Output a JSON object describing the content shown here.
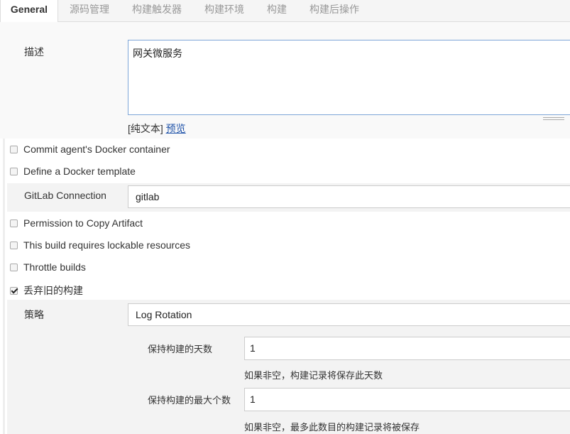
{
  "tabs": [
    {
      "label": "General",
      "active": true
    },
    {
      "label": "源码管理"
    },
    {
      "label": "构建触发器"
    },
    {
      "label": "构建环境"
    },
    {
      "label": "构建"
    },
    {
      "label": "构建后操作"
    }
  ],
  "description": {
    "label": "描述",
    "value": "网关微服务",
    "plain_text": "[纯文本]",
    "preview_link": "预览"
  },
  "options": {
    "commit_docker": {
      "label": "Commit agent's Docker container",
      "checked": false
    },
    "define_docker": {
      "label": "Define a Docker template",
      "checked": false
    },
    "permission_copy": {
      "label": "Permission to Copy Artifact",
      "checked": false
    },
    "lockable": {
      "label": "This build requires lockable resources",
      "checked": false
    },
    "throttle": {
      "label": "Throttle builds",
      "checked": false
    },
    "discard_old": {
      "label": "丢弃旧的构建",
      "checked": true
    }
  },
  "gitlab": {
    "label": "GitLab Connection",
    "value": "gitlab"
  },
  "strategy": {
    "label": "策略",
    "value": "Log Rotation"
  },
  "days_to_keep": {
    "label": "保持构建的天数",
    "value": "1",
    "help": "如果非空，构建记录将保存此天数"
  },
  "max_builds": {
    "label": "保持构建的最大个数",
    "value": "1",
    "help": "如果非空，最多此数目的构建记录将被保存"
  },
  "colors": {
    "link": "#2255aa",
    "textarea_border": "#7ea6d8"
  }
}
